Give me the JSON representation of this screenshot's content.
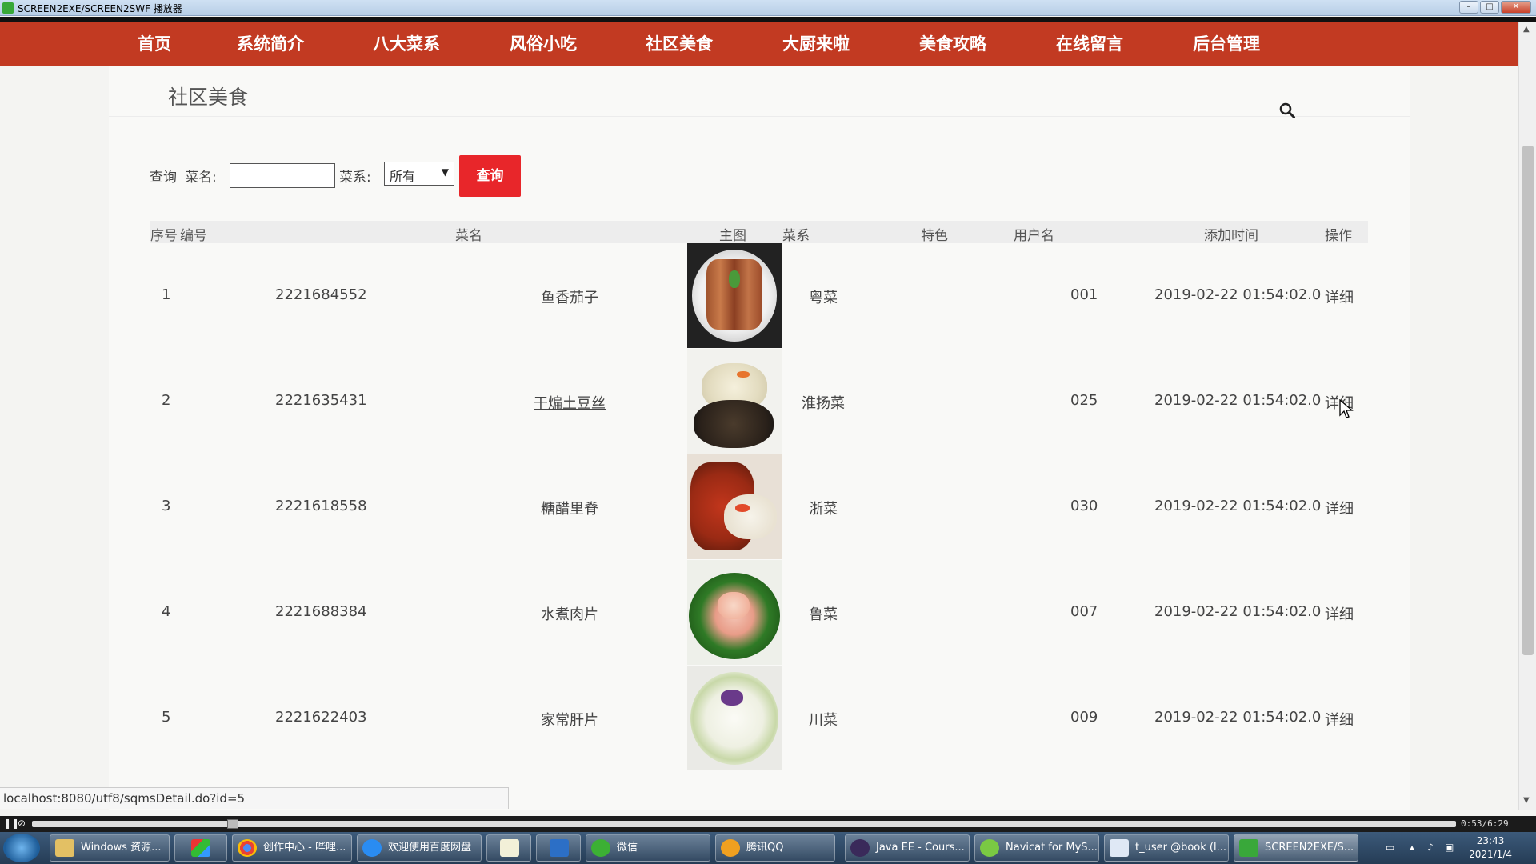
{
  "window": {
    "title": "SCREEN2EXE/SCREEN2SWF 播放器",
    "buttons": [
      "–",
      "□",
      "✕"
    ]
  },
  "nav": {
    "items": [
      {
        "label": "首页"
      },
      {
        "label": "系统简介"
      },
      {
        "label": "八大菜系"
      },
      {
        "label": "风俗小吃"
      },
      {
        "label": "社区美食"
      },
      {
        "label": "大厨来啦"
      },
      {
        "label": "美食攻略"
      },
      {
        "label": "在线留言"
      },
      {
        "label": "后台管理"
      }
    ],
    "color": "#c23a22"
  },
  "page": {
    "title": "社区美食",
    "search_icon": "search-icon"
  },
  "filter": {
    "query_label": "查询",
    "name_label": "菜名:",
    "name_value": "",
    "cuisine_label": "菜系:",
    "cuisine_selected": "所有",
    "submit_label": "查询",
    "submit_color": "#e8262a"
  },
  "table": {
    "headers": [
      "序号",
      "编号",
      "菜名",
      "主图",
      "菜系",
      "特色",
      "用户名",
      "添加时间",
      "操作"
    ],
    "rows": [
      {
        "index": "1",
        "code": "2221684552",
        "name": "鱼香茄子",
        "cuisine": "粤菜",
        "feature": "",
        "user": "001",
        "time": "2019-02-22 01:54:02.0",
        "action": "详细"
      },
      {
        "index": "2",
        "code": "2221635431",
        "name": "干煸土豆丝",
        "cuisine": "淮扬菜",
        "feature": "",
        "user": "025",
        "time": "2019-02-22 01:54:02.0",
        "action": "详细"
      },
      {
        "index": "3",
        "code": "2221618558",
        "name": "糖醋里脊",
        "cuisine": "浙菜",
        "feature": "",
        "user": "030",
        "time": "2019-02-22 01:54:02.0",
        "action": "详细"
      },
      {
        "index": "4",
        "code": "2221688384",
        "name": "水煮肉片",
        "cuisine": "鲁菜",
        "feature": "",
        "user": "007",
        "time": "2019-02-22 01:54:02.0",
        "action": "详细"
      },
      {
        "index": "5",
        "code": "2221622403",
        "name": "家常肝片",
        "cuisine": "川菜",
        "feature": "",
        "user": "009",
        "time": "2019-02-22 01:54:02.0",
        "action": "详细"
      }
    ]
  },
  "status": {
    "url": "localhost:8080/utf8/sqmsDetail.do?id=5"
  },
  "player": {
    "time": "0:53/6:29"
  },
  "taskbar": {
    "items": [
      {
        "label": "Windows 资源..."
      },
      {
        "label": ""
      },
      {
        "label": "创作中心 - 哔哩..."
      },
      {
        "label": "欢迎使用百度网盘"
      },
      {
        "label": ""
      },
      {
        "label": ""
      },
      {
        "label": "微信"
      },
      {
        "label": "腾讯QQ"
      },
      {
        "label": "Java EE - Cours..."
      },
      {
        "label": "Navicat for MyS..."
      },
      {
        "label": "t_user @book (l..."
      },
      {
        "label": "SCREEN2EXE/S..."
      }
    ],
    "clock_time": "23:43",
    "clock_date": "2021/1/4"
  }
}
